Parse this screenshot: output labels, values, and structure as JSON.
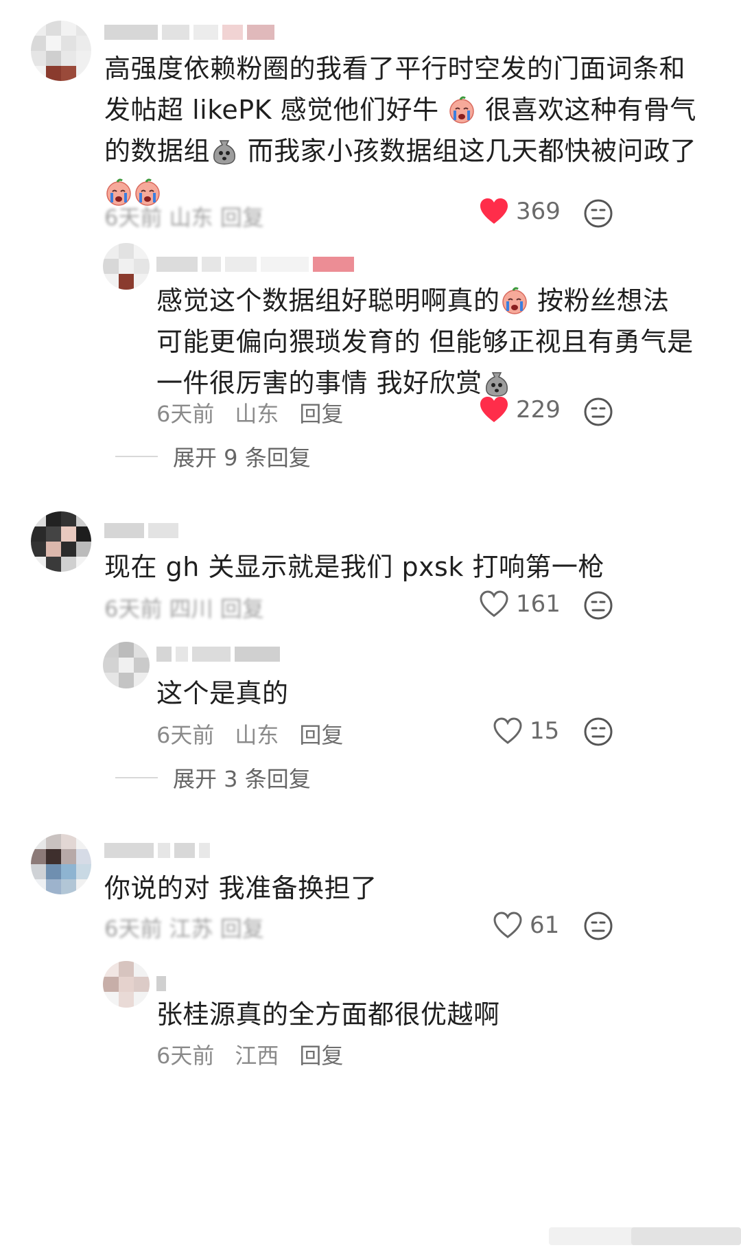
{
  "comments": [
    {
      "text_lines": [
        "高强度依赖粉圈的我看了平行时空发的门面词条和",
        "发帖超 likePK 感觉他们好牛",
        "的数据组",
        "而我家小孩数据组这几天都快被问政了"
      ],
      "likes": "369",
      "liked": true,
      "meta_blurred": "6天前 山东 回复"
    },
    {
      "reply": true,
      "text_lines": [
        "感觉这个数据组好聪明啊真的",
        "按粉丝想法",
        "可能更偏向猥琐发育的 但能够正视且有勇气是",
        "一件很厉害的事情 我好欣赏"
      ],
      "time": "6天前",
      "location": "山东",
      "reply_label": "回复",
      "likes": "229",
      "liked": true,
      "expand_label": "展开 9 条回复"
    },
    {
      "text": "现在 gh 关显示就是我们 pxsk 打响第一枪",
      "likes": "161",
      "liked": false,
      "meta_blurred": "6天前 四川 回复"
    },
    {
      "reply": true,
      "text": "这个是真的",
      "time": "6天前",
      "location": "山东",
      "reply_label": "回复",
      "likes": "15",
      "liked": false,
      "expand_label": "展开 3 条回复"
    },
    {
      "text": "你说的对 我准备换担了",
      "likes": "61",
      "liked": false,
      "meta_blurred": "6天前 江苏 回复"
    },
    {
      "reply": true,
      "text": "张桂源真的全方面都很优越啊",
      "time": "6天前",
      "location": "江西",
      "reply_label": "回复"
    }
  ],
  "colors": {
    "heart_red": "#ff2d4a",
    "meta_gray": "#8a8a8a",
    "text": "#1f1f1f"
  },
  "icons": [
    "heart-icon",
    "dislike-face-icon",
    "crying-emoji-icon",
    "sack-emoji-icon"
  ]
}
